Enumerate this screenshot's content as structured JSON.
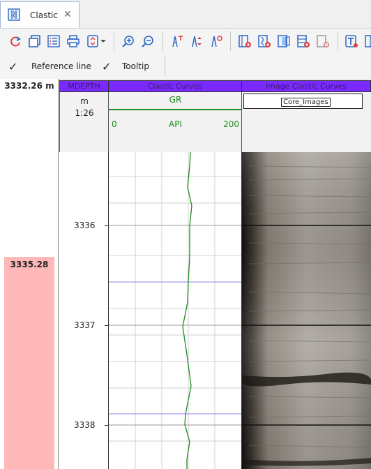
{
  "tab": {
    "label": "Clastic",
    "close": "✕",
    "icon": "well-log-icon"
  },
  "toolbar": {
    "icons": [
      "refresh-icon",
      "copy-icon",
      "list-icon",
      "print-icon",
      "layout-dropdown-icon",
      "zoom-in-icon",
      "zoom-out-icon",
      "track-add-icon",
      "track-scale-icon",
      "track-marker-icon",
      "insert-track-icon",
      "insert-curve-icon",
      "insert-image-icon",
      "insert-table-icon",
      "delete-track-icon",
      "text-tool-icon",
      "multi-track-icon"
    ]
  },
  "options": {
    "reference_line": {
      "check": "✓",
      "label": "Reference line"
    },
    "tooltip": {
      "check": "✓",
      "label": "Tooltip"
    }
  },
  "depth_pane": {
    "top_depth": "3332.26 m",
    "cursor_depth": "3335.28"
  },
  "tracks": {
    "depth": {
      "title": "MDEPTH",
      "unit": "m",
      "scale": "1:26",
      "labels": [
        "3336",
        "3337",
        "3338"
      ]
    },
    "curve": {
      "title": "Clastic Curves",
      "curve_name": "GR",
      "min": "0",
      "unit": "API",
      "max": "200",
      "color": "#1f8a1f"
    },
    "image": {
      "title": "Image Clastic Curves",
      "image_name": "Core_Images"
    }
  },
  "colors": {
    "header_bg": "#7a2aff",
    "depth_highlight": "#ffb8b8",
    "reference_line": "#8a86e8",
    "grid": "#d0d0d0"
  }
}
